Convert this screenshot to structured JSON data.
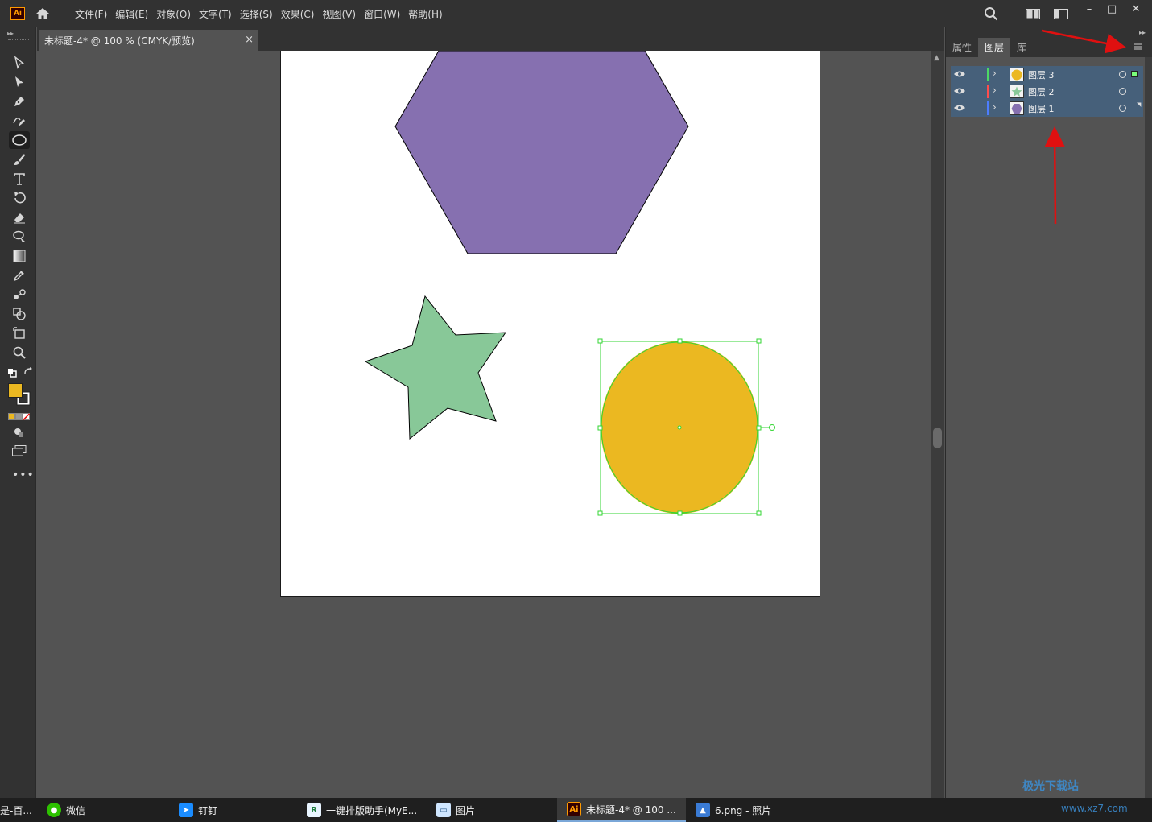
{
  "app": {
    "logo": "Ai"
  },
  "menu": [
    "文件(F)",
    "编辑(E)",
    "对象(O)",
    "文字(T)",
    "选择(S)",
    "效果(C)",
    "视图(V)",
    "窗口(W)",
    "帮助(H)"
  ],
  "window_controls": {
    "minimize": "–",
    "maximize": "□",
    "close": "✕"
  },
  "document_tab": {
    "title": "未标题-4* @ 100 % (CMYK/预览)",
    "close": "×"
  },
  "panel": {
    "tabs": [
      "属性",
      "图层",
      "库"
    ],
    "active_tab": "图层",
    "layers": [
      {
        "name": "图层  3",
        "color": "#4cd964",
        "thumb": "circle",
        "thumb_color": "#ebb821",
        "selected_art": true
      },
      {
        "name": "图层  2",
        "color": "#ff4d4d",
        "thumb": "star",
        "thumb_color": "#88c898",
        "selected_art": false
      },
      {
        "name": "图层  1",
        "color": "#4d7dff",
        "thumb": "hexagon",
        "thumb_color": "#8670b0",
        "selected_art": false
      }
    ]
  },
  "artwork": {
    "hexagon_fill": "#8670b0",
    "star_fill": "#88c898",
    "circle_fill": "#ebb821",
    "selection_color": "#33d633"
  },
  "tool_icons": [
    "selection-tool-icon",
    "direct-selection-tool-icon",
    "pen-tool-icon",
    "curvature-tool-icon",
    "ellipse-tool-icon",
    "paintbrush-tool-icon",
    "type-tool-icon",
    "rotate-tool-icon",
    "eraser-tool-icon",
    "lasso-tool-icon",
    "gradient-tool-icon",
    "eyedropper-tool-icon",
    "blend-tool-icon",
    "shape-builder-tool-icon",
    "artboard-tool-icon",
    "zoom-tool-icon"
  ],
  "fill_color": "#ebb821",
  "taskbar": {
    "items": [
      {
        "label": "是-百...",
        "active": false
      },
      {
        "label": "微信",
        "active": false
      },
      {
        "label": "钉钉",
        "active": false
      },
      {
        "label": "一键排版助手(MyE...",
        "active": false
      },
      {
        "label": "图片",
        "active": false
      },
      {
        "label": "未标题-4* @ 100 ...",
        "active": true
      },
      {
        "label": "6.png - 照片",
        "active": false
      }
    ]
  },
  "watermark": {
    "brand": "极光下载站",
    "url": "www.xz7.com"
  }
}
